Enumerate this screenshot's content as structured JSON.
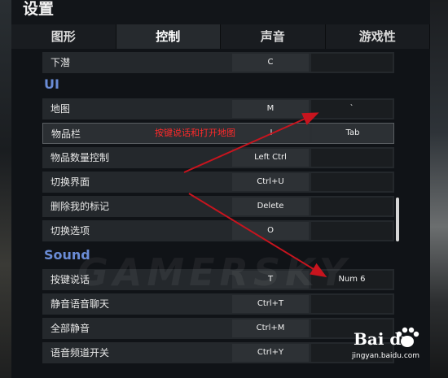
{
  "title": "设置",
  "tabs": [
    {
      "label": "图形"
    },
    {
      "label": "控制"
    },
    {
      "label": "声音"
    },
    {
      "label": "游戏性"
    }
  ],
  "active_tab": "控制",
  "rows": [
    {
      "label": "下潜",
      "key1": "C",
      "key2": ""
    },
    {
      "label": "地图",
      "key1": "M",
      "key2": "`"
    },
    {
      "label": "物品栏",
      "key1": "I",
      "key2": "Tab"
    },
    {
      "label": "物品数量控制",
      "key1": "Left Ctrl",
      "key2": ""
    },
    {
      "label": "切换界面",
      "key1": "Ctrl+U",
      "key2": ""
    },
    {
      "label": "删除我的标记",
      "key1": "Delete",
      "key2": ""
    },
    {
      "label": "切换选项",
      "key1": "O",
      "key2": ""
    },
    {
      "label": "按键说话",
      "key1": "T",
      "key2": "Num 6"
    },
    {
      "label": "静音语音聊天",
      "key1": "Ctrl+T",
      "key2": ""
    },
    {
      "label": "全部静音",
      "key1": "Ctrl+M",
      "key2": ""
    },
    {
      "label": "语音频道开关",
      "key1": "Ctrl+Y",
      "key2": ""
    }
  ],
  "sections": {
    "ui": "UI",
    "sound": "Sound"
  },
  "annotation": "按键说话和打开地图",
  "watermark": "GAMERSKY",
  "baidu": {
    "logo": "Bai du",
    "url": "jingyan.baidu.com"
  },
  "colors": {
    "section": "#6a8cd6",
    "annotation": "#ff2a2a",
    "arrow": "#c8141e"
  }
}
